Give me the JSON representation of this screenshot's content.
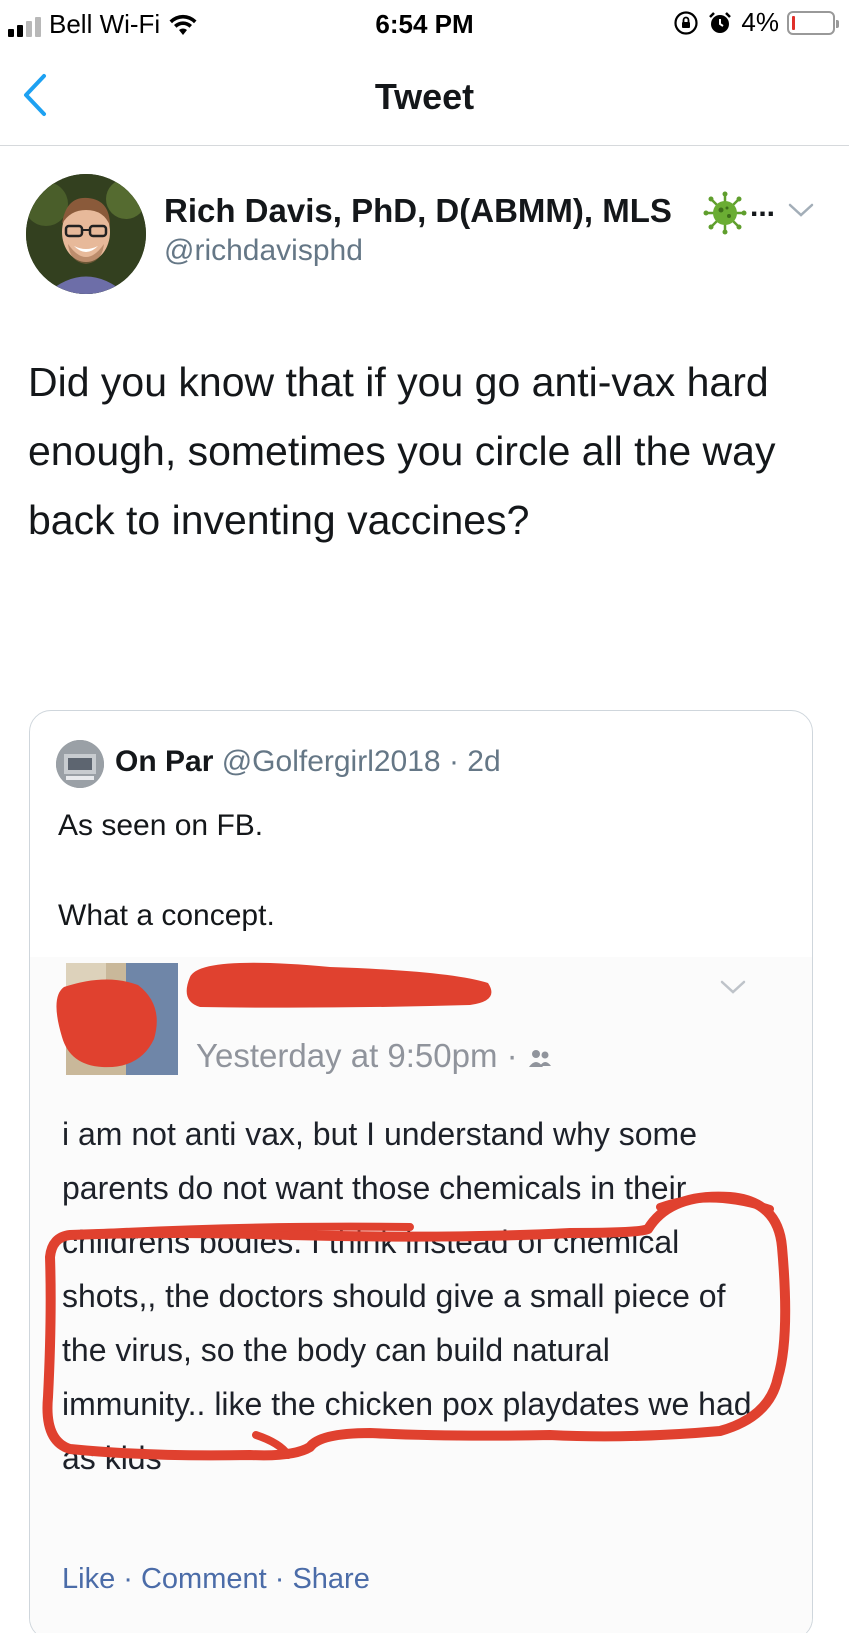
{
  "status_bar": {
    "carrier": "Bell Wi-Fi",
    "time": "6:54 PM",
    "battery": "4%",
    "battery_level": 0.04
  },
  "nav": {
    "title": "Tweet"
  },
  "tweet": {
    "author_name": "Rich Davis, PhD, D(ABMM), MLS",
    "ellipsis": "...",
    "handle": "@richdavisphd",
    "text": "Did you know that if you go anti-vax hard enough, sometimes you circle all the way back to inventing vaccines?"
  },
  "quoted_tweet": {
    "name": "On Par",
    "handle_time": "@Golfergirl2018 · 2d",
    "line1": "As seen on FB.",
    "line2": "What a concept."
  },
  "facebook_post": {
    "timestamp": "Yesterday at 9:50pm ·",
    "body": "i am not anti vax, but I understand why some parents do not want those chemicals in their childrens bodies. I think instead of chemical shots,, the doctors should give a small piece of the virus, so the body can build natural immunity.. like the chicken pox playdates we had as kids",
    "actions": "Like · Comment · Share"
  },
  "colors": {
    "twitter_blue": "#1da1f2",
    "secondary_text": "#657786",
    "redaction_red": "#e0412f",
    "virus_green": "#5f9e2d"
  },
  "icons": [
    "signal-icon",
    "wifi-icon",
    "orientation-lock-icon",
    "alarm-icon",
    "battery-icon",
    "back-chevron-icon",
    "virus-emoji-icon",
    "chevron-down-icon",
    "friends-icon"
  ]
}
